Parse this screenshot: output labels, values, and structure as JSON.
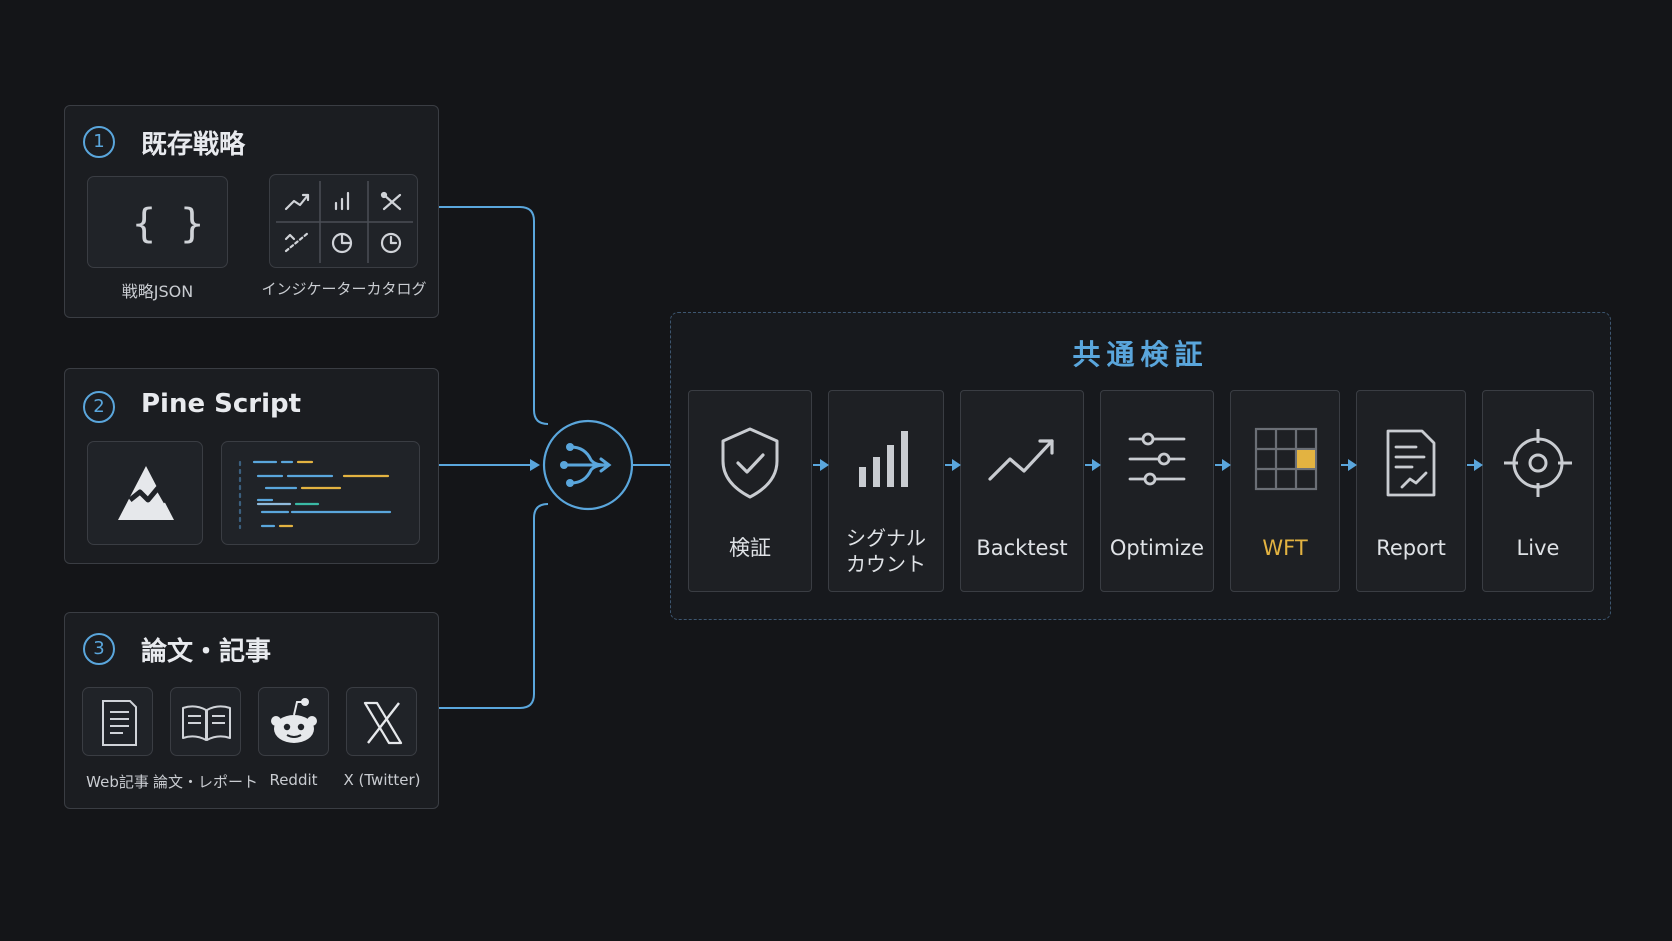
{
  "sources": [
    {
      "number": "1",
      "title": "既存戦略",
      "items": [
        {
          "label": "戦略JSON",
          "icon": "curly-braces-icon"
        },
        {
          "label": "インジケーターカタログ",
          "icon": "indicator-grid-icon"
        }
      ]
    },
    {
      "number": "2",
      "title": "Pine Script",
      "items": [
        {
          "label": "",
          "icon": "mountain-logo-icon"
        },
        {
          "label": "",
          "icon": "code-lines-icon"
        }
      ]
    },
    {
      "number": "3",
      "title": "論文・記事",
      "items": [
        {
          "label": "Web記事",
          "icon": "document-icon"
        },
        {
          "label": "論文・レポート",
          "icon": "open-book-icon"
        },
        {
          "label": "Reddit",
          "icon": "reddit-icon"
        },
        {
          "label": "X (Twitter)",
          "icon": "x-logo-icon"
        }
      ]
    }
  ],
  "merge_icon": "merge-arrows-icon",
  "pipeline": {
    "title": "共通検証",
    "steps": [
      {
        "label": "検証",
        "icon": "shield-check-icon"
      },
      {
        "label_line1": "シグナル",
        "label_line2": "カウント",
        "icon": "signal-bars-icon"
      },
      {
        "label": "Backtest",
        "icon": "trend-up-icon"
      },
      {
        "label": "Optimize",
        "icon": "sliders-icon"
      },
      {
        "label": "WFT",
        "icon": "grid-highlight-icon",
        "highlight_color": "#e3b341"
      },
      {
        "label": "Report",
        "icon": "report-chart-icon"
      },
      {
        "label": "Live",
        "icon": "crosshair-icon"
      }
    ]
  },
  "colors": {
    "background": "#141518",
    "accent": "#5aa6dc",
    "highlight": "#e3b341",
    "panel": "#1b1d21",
    "border": "#3a3d43"
  }
}
